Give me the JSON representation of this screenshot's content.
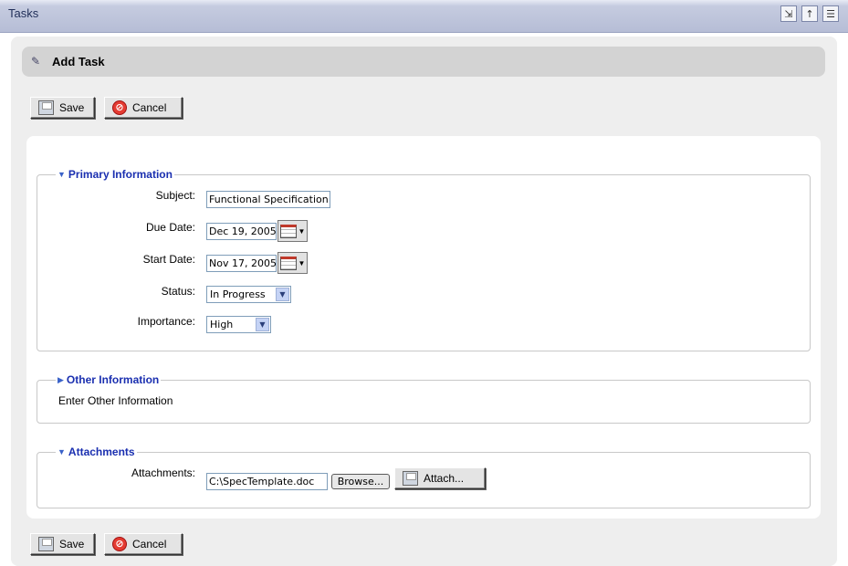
{
  "window": {
    "title": "Tasks"
  },
  "title_icons": [
    "export-icon",
    "up-arrow-icon",
    "list-icon"
  ],
  "header": {
    "title": "Add Task"
  },
  "toolbar": {
    "save_label": "Save",
    "cancel_label": "Cancel"
  },
  "primary": {
    "legend": "Primary Information",
    "subject_label": "Subject:",
    "subject_value": "Functional Specification",
    "due_label": "Due Date:",
    "due_value": "Dec 19, 2005",
    "start_label": "Start Date:",
    "start_value": "Nov 17, 2005",
    "status_label": "Status:",
    "status_value": "In Progress",
    "importance_label": "Importance:",
    "importance_value": "High"
  },
  "other": {
    "legend": "Other Information",
    "text": "Enter Other Information"
  },
  "attachments": {
    "legend": "Attachments",
    "label": "Attachments:",
    "file_value": "C:\\SpecTemplate.doc",
    "browse_label": "Browse...",
    "attach_label": "Attach..."
  },
  "colors": {
    "legend": "#1a2fb0",
    "titlebar": "#c9cfe2",
    "panel_bg": "#eeeeee"
  }
}
